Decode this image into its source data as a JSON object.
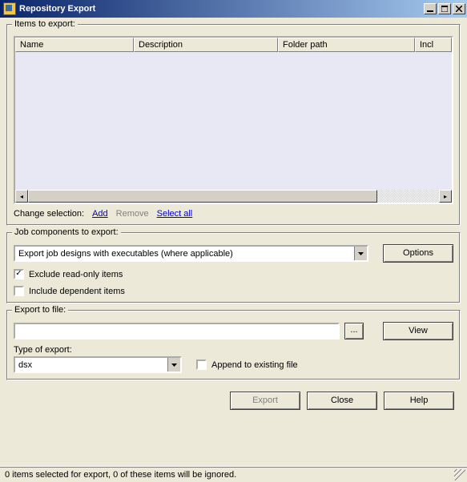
{
  "window": {
    "title": "Repository Export"
  },
  "items_group": {
    "legend": "Items to export:",
    "columns": {
      "name": "Name",
      "description": "Description",
      "folder_path": "Folder path",
      "include": "Incl"
    },
    "change_selection": {
      "label": "Change selection:",
      "add": "Add",
      "remove": "Remove",
      "select_all": "Select all"
    }
  },
  "job_group": {
    "legend": "Job components to export:",
    "combo_value": "Export job designs with executables (where applicable)",
    "options_button": "Options",
    "exclude_readonly": {
      "label": "Exclude read-only items",
      "checked": true
    },
    "include_dependent": {
      "label": "Include dependent items",
      "checked": false
    }
  },
  "export_group": {
    "legend": "Export to file:",
    "path_value": "",
    "browse": "...",
    "view_button": "View",
    "type_label": "Type of export:",
    "type_value": "dsx",
    "append": {
      "label": "Append to existing file",
      "checked": false
    }
  },
  "buttons": {
    "export": "Export",
    "close": "Close",
    "help": "Help"
  },
  "status": "0 items selected for export, 0 of these items will be ignored."
}
